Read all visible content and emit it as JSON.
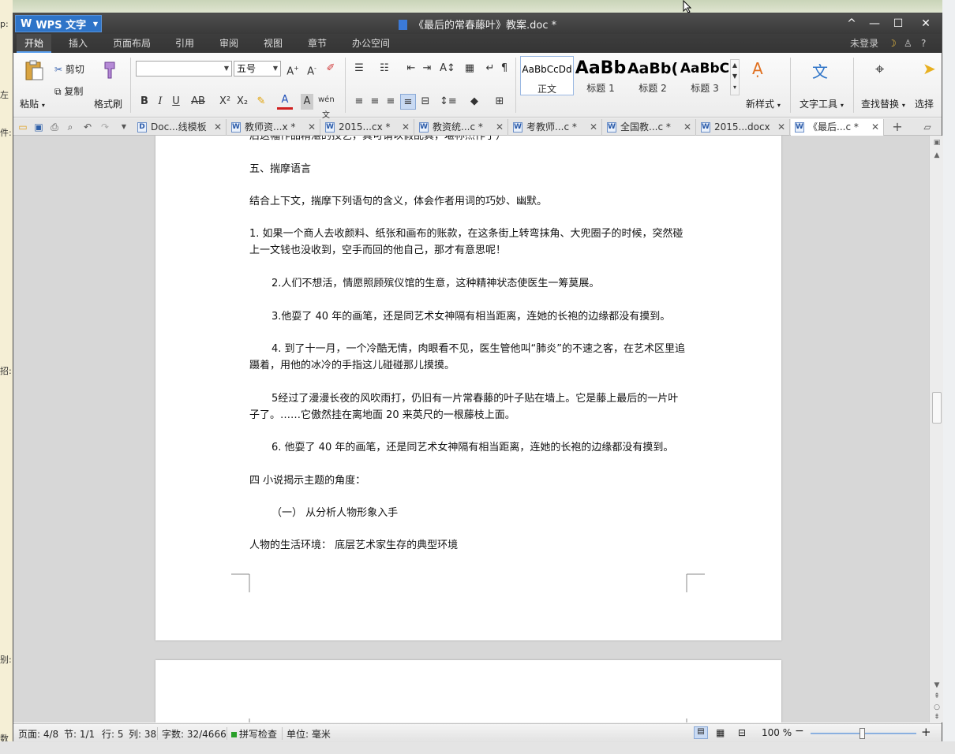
{
  "background": {
    "left_texts": [
      "p:",
      "左",
      "件:",
      "招:",
      "别:",
      "数"
    ]
  },
  "titlebar": {
    "app_name": "WPS 文字",
    "doc_title": "《最后的常春藤叶》教案.doc *",
    "controls": [
      "^",
      "—",
      "☐",
      "✕"
    ]
  },
  "menubar": {
    "items": [
      "开始",
      "插入",
      "页面布局",
      "引用",
      "审阅",
      "视图",
      "章节",
      "办公空间"
    ],
    "login": "未登录",
    "help": "?"
  },
  "ribbon": {
    "paste": "粘贴",
    "cut": "剪切",
    "copy": "复制",
    "format_painter": "格式刷",
    "font_name": "",
    "font_size": "五号",
    "styles": [
      {
        "sample": "AaBbCcDd",
        "label": "正文"
      },
      {
        "sample": "AaBb",
        "label": "标题 1"
      },
      {
        "sample": "AaBb(",
        "label": "标题 2"
      },
      {
        "sample": "AaBbC",
        "label": "标题 3"
      }
    ],
    "new_style": "新样式",
    "text_tools": "文字工具",
    "find_replace": "查找替换",
    "select": "选择"
  },
  "tabs": [
    {
      "label": "Doc...线模板",
      "icon": "D",
      "active": false
    },
    {
      "label": "教师资...x *",
      "icon": "W",
      "active": false
    },
    {
      "label": "2015...cx *",
      "icon": "W",
      "active": false
    },
    {
      "label": "教资统...c *",
      "icon": "W",
      "active": false
    },
    {
      "label": "考教师...c *",
      "icon": "W",
      "active": false
    },
    {
      "label": "全国教...c *",
      "icon": "W",
      "active": false
    },
    {
      "label": "2015...docx",
      "icon": "W",
      "active": false
    },
    {
      "label": "《最后...c *",
      "icon": "W",
      "active": true
    }
  ],
  "document": {
    "paragraphs": [
      "后这幅作品精湛的技艺，真可谓以假乱真，堪称杰作了）",
      "五、揣摩语言",
      "结合上下文，揣摩下列语句的含义，体会作者用词的巧妙、幽默。",
      "1. 如果一个商人去收颜料、纸张和画布的账款，在这条街上转弯抹角、大兜圈子的时候，突然碰上一文钱也没收到，空手而回的他自己，那才有意思呢！",
      "2.人们不想活，情愿照顾殡仪馆的生意，这种精神状态使医生一筹莫展。",
      "3.他耍了 40 年的画笔，还是同艺术女神隔有相当距离，连她的长袍的边缘都没有摸到。",
      "4. 到了十一月，一个冷酷无情，肉眼看不见，医生管他叫“肺炎”的不速之客，在艺术区里追蹑着，用他的冰冷的手指这儿碰碰那儿摸摸。",
      "5经过了漫漫长夜的风吹雨打，仍旧有一片常春藤的叶子贴在墙上。它是藤上最后的一片叶子了。……它傲然挂在离地面 20 来英尺的一根藤枝上面。",
      "6. 他耍了 40 年的画笔，还是同艺术女神隔有相当距离，连她的长袍的边缘都没有摸到。",
      "四 小说揭示主题的角度：",
      "（一） 从分析人物形象入手",
      "人物的生活环境： 底层艺术家生存的典型环境"
    ]
  },
  "statusbar": {
    "page": "页面: 4/8",
    "section": "节: 1/1",
    "line": "行: 5",
    "column": "列: 38",
    "word_count": "字数: 32/4666",
    "spell_check": "拼写检查",
    "unit": "单位: 毫米",
    "zoom": "100 %",
    "zoom_level": 1.0
  },
  "colors": {
    "accent": "#2e74c8",
    "titlebar": "#3f3f3f"
  }
}
